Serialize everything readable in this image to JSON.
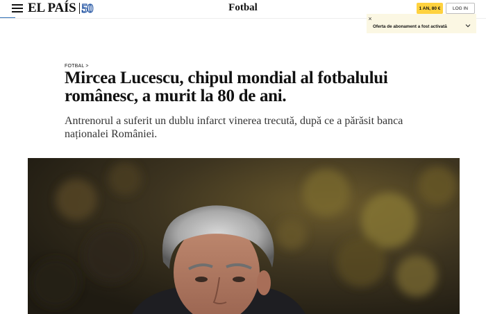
{
  "header": {
    "logo_text": "EL PAÍS",
    "logo_anniversary": "50",
    "section": "Fotbal",
    "subscribe_label": "1 AN, 80 €",
    "login_label": "LOG IN"
  },
  "notification": {
    "text": "Oferta de abonament a fost activată",
    "close_symbol": "×"
  },
  "article": {
    "kicker": "FOTBAL >",
    "headline": "Mircea Lucescu, chipul mondial al fotbalului românesc, a murit la 80 de ani.",
    "dek": "Antrenorul a suferit un dublu infarct vinerea trecută, după ce a părăsit banca naționalei României."
  },
  "colors": {
    "accent_blue": "#2f6fb5",
    "subscribe_yellow": "#ffd23f",
    "notice_bg": "#fbf7e3"
  },
  "icons": {
    "menu": "hamburger-menu-icon",
    "close": "close-icon",
    "chevron": "chevron-down-icon"
  }
}
